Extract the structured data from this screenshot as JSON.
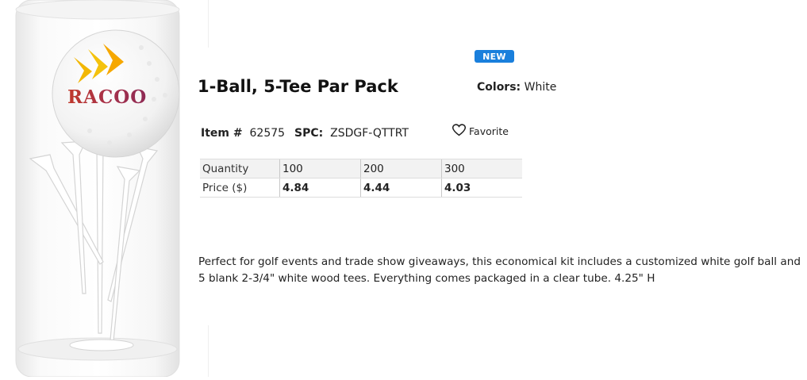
{
  "product": {
    "badge": "NEW",
    "title": "1-Ball, 5-Tee Par Pack",
    "colors_label": "Colors:",
    "colors_value": "White",
    "item_label": "Item #",
    "item_number": "62575",
    "spc_label": "SPC:",
    "spc_value": "ZSDGF-QTTRT",
    "favorite_label": "Favorite",
    "image_logo_text": "RACOO",
    "description": "Perfect for golf events and trade show giveaways, this economical kit includes a customized white golf ball and 5 blank 2-3/4\" white wood tees. Everything comes packaged in a clear tube.  4.25\" H"
  },
  "pricing": {
    "quantity_label": "Quantity",
    "price_label": "Price ($)",
    "quantities": [
      "100",
      "200",
      "300"
    ],
    "prices": [
      "4.84",
      "4.44",
      "4.03"
    ]
  },
  "colors": {
    "badge_bg": "#1a7fdc",
    "logo_red": "#c0392b",
    "logo_yellow": "#f2b705"
  },
  "icons": {
    "favorite": "heart-outline-icon"
  }
}
